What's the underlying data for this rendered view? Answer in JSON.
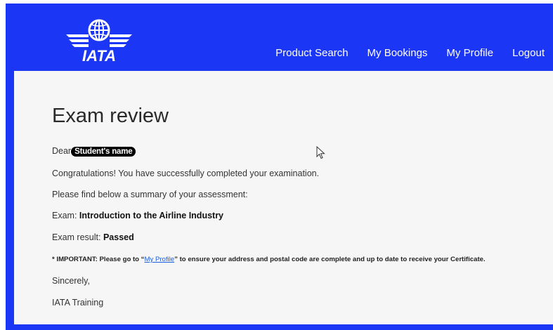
{
  "header": {
    "logo_text": "IATA",
    "nav": [
      {
        "label": "Product Search"
      },
      {
        "label": "My Bookings"
      },
      {
        "label": "My Profile"
      },
      {
        "label": "Logout"
      }
    ]
  },
  "main": {
    "title": "Exam review",
    "greeting_prefix": "Dear",
    "student_name": "Student's name",
    "congrats": "Congratulations!  You have successfully completed your examination.",
    "summary_intro": "Please find below a summary of your assessment:",
    "exam_label": "Exam:",
    "exam_value": "Introduction to the Airline Industry",
    "result_label": "Exam result:",
    "result_value": "Passed",
    "important_prefix": "* IMPORTANT: Please go to “",
    "important_link": "My Profile",
    "important_suffix": "” to ensure your address and postal code are complete and up to date to receive your Certificate.",
    "closing": "Sincerely,",
    "signature": "IATA Training"
  },
  "colors": {
    "brand_blue": "#1c36f5",
    "content_bg": "#f6f6f6",
    "link": "#1a5ce0"
  }
}
